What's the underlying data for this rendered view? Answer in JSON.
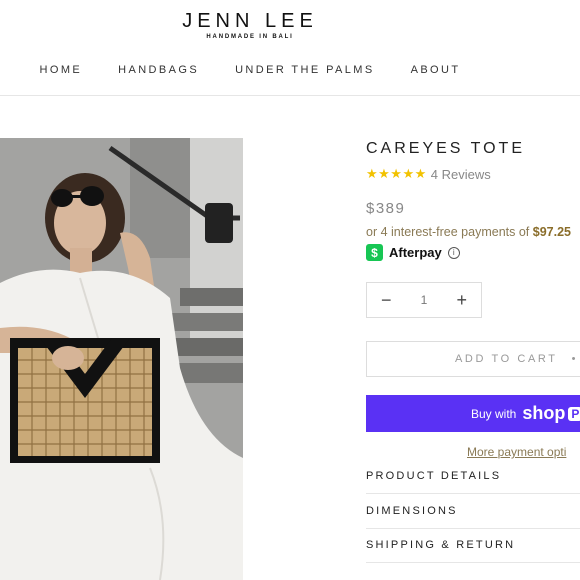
{
  "brand": {
    "name": "JENN LEE",
    "tagline": "HANDMADE IN BALI"
  },
  "nav": {
    "items": [
      "HOME",
      "HANDBAGS",
      "UNDER THE PALMS",
      "ABOUT"
    ]
  },
  "product": {
    "title": "CAREYES TOTE",
    "stars": "★★★★★",
    "rating": 5,
    "reviews": "4 Reviews",
    "price": "$389",
    "installments_prefix": "or 4 interest-free payments of ",
    "installment_amount": "$97.25",
    "afterpay_label": "Afterpay",
    "afterpay_icon": "$",
    "info_icon": "i",
    "quantity": "1",
    "minus": "−",
    "plus": "+",
    "add_to_cart": "ADD TO CART",
    "add_to_cart_dot": "•",
    "buy_with": "Buy with",
    "shop_word": "shop",
    "pay_letter": "P",
    "more_payment": "More payment opti",
    "accordion": [
      "PRODUCT DETAILS",
      "DIMENSIONS",
      "SHIPPING & RETURN"
    ]
  },
  "colors": {
    "accent_gold": "#8a7a55",
    "shop_pay": "#5a31f4",
    "afterpay": "#17c654",
    "star": "#f2c200"
  }
}
